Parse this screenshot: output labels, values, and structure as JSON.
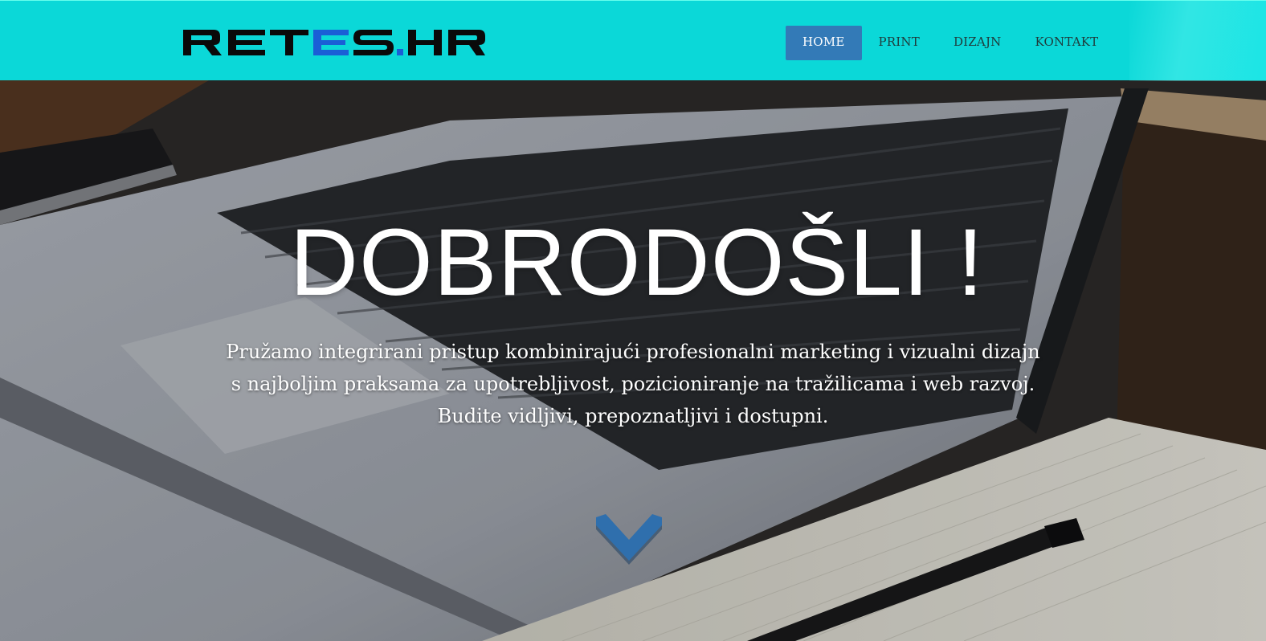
{
  "site": {
    "logo_text": "RETES.HR"
  },
  "nav": {
    "items": [
      {
        "label": "HOME",
        "active": true
      },
      {
        "label": "PRINT",
        "active": false
      },
      {
        "label": "DIZAJN",
        "active": false
      },
      {
        "label": "KONTAKT",
        "active": false
      }
    ]
  },
  "hero": {
    "title": "DOBRODOŠLI !",
    "lines": [
      "Pružamo integrirani pristup kombinirajući profesionalni marketing i vizualni dizajn",
      "s najboljim praksama za upotrebljivost, pozicioniranje na tražilicama i web razvoj.",
      "Budite vidljivi, prepoznatljivi i dostupni."
    ],
    "scroll_icon": "chevron-down-icon",
    "background_image": "laptop-notebook-pen-on-desk"
  },
  "colors": {
    "navbar": "#0bd8d8",
    "nav_active": "#337ab7",
    "logo_dark": "#0a0a0a",
    "logo_accent": "#1a5fd6",
    "chevron": "#2f6fad"
  }
}
